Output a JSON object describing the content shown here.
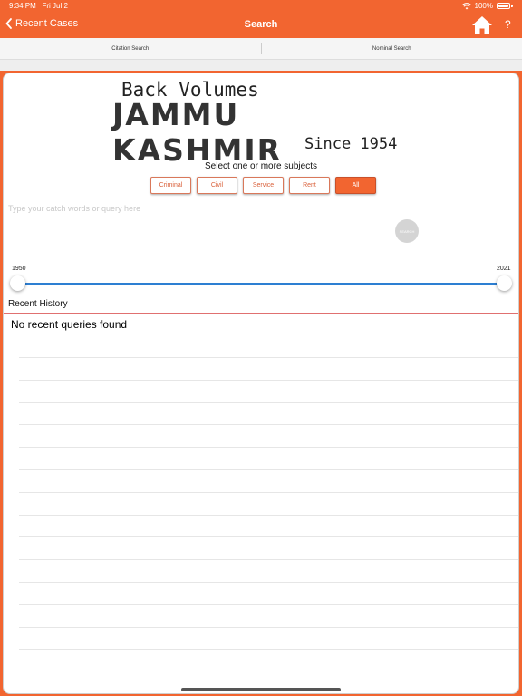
{
  "status_bar": {
    "time": "9:34 PM",
    "date": "Fri Jul 2",
    "battery": "100%"
  },
  "nav": {
    "back_label": "Recent Cases",
    "title": "Search",
    "help_label": "?"
  },
  "tabs": [
    {
      "label": "Citation Search"
    },
    {
      "label": "Nominal Search"
    }
  ],
  "logo": {
    "line1": "Back Volumes",
    "line2": "JAMMU KASHMIR",
    "line3": "Since 1954"
  },
  "subjects": {
    "title": "Select one or more subjects",
    "chips": [
      {
        "label": "Criminal",
        "selected": false
      },
      {
        "label": "Civil",
        "selected": false
      },
      {
        "label": "Service",
        "selected": false
      },
      {
        "label": "Rent",
        "selected": false
      },
      {
        "label": "All",
        "selected": true
      }
    ]
  },
  "query": {
    "placeholder": "Type your catch words or query here",
    "value": ""
  },
  "search_button_label": "SEARCH",
  "year_range": {
    "min": "1950",
    "max": "2021"
  },
  "history": {
    "title": "Recent History",
    "empty_message": "No recent queries found"
  },
  "colors": {
    "accent": "#f26530",
    "slider": "#2d7fd2",
    "divider": "#e07070"
  }
}
